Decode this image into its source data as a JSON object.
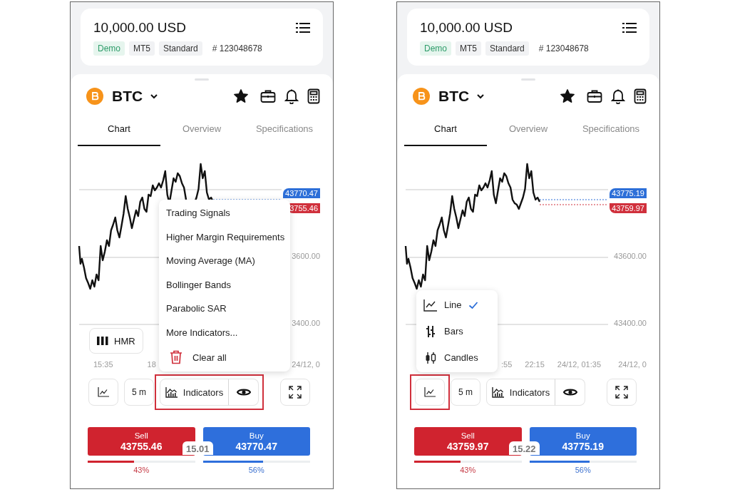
{
  "panels": [
    {
      "account": {
        "balance": "10,000.00 USD",
        "tags": [
          {
            "label": "Demo",
            "kind": "status"
          },
          {
            "label": "MT5",
            "kind": "plain"
          },
          {
            "label": "Standard",
            "kind": "plain"
          }
        ],
        "number": "# 123048678"
      },
      "symbol": "BTC",
      "favorite": true,
      "tabs": [
        {
          "label": "Chart",
          "selected": true
        },
        {
          "label": "Overview",
          "selected": false
        },
        {
          "label": "Specifications",
          "selected": false
        }
      ],
      "chart": {
        "y_labels": [
          "3600.00",
          "3400.00"
        ],
        "x_labels": [
          "15:35",
          "18",
          "24/12, 0"
        ],
        "ask_price": "43770.47",
        "bid_price": "3755.46",
        "hmr_button": "HMR"
      },
      "popup": {
        "kind": "indicators",
        "items": [
          {
            "label": "Trading Signals",
            "kind": "option"
          },
          {
            "label": "Higher Margin Requirements",
            "kind": "option"
          },
          {
            "label": "Moving Average (MA)",
            "kind": "option"
          },
          {
            "label": "Bollinger Bands",
            "kind": "option"
          },
          {
            "label": "Parabolic SAR",
            "kind": "option"
          },
          {
            "label": "More Indicators...",
            "kind": "option"
          },
          {
            "label": "Clear all",
            "kind": "clear"
          }
        ]
      },
      "toolbar": {
        "timeframe": "5 m",
        "indicators": "Indicators",
        "chart_type_highlighted": false,
        "indicators_highlighted": true
      },
      "trade": {
        "sell": {
          "label": "Sell",
          "price": "43755.46"
        },
        "buy": {
          "label": "Buy",
          "price": "43770.47"
        },
        "spread": "15.01",
        "sell_share": {
          "level": 0.43,
          "reading": "43%"
        },
        "buy_share": {
          "level": 0.56,
          "reading": "56%"
        }
      }
    },
    {
      "account": {
        "balance": "10,000.00 USD",
        "tags": [
          {
            "label": "Demo",
            "kind": "status"
          },
          {
            "label": "MT5",
            "kind": "plain"
          },
          {
            "label": "Standard",
            "kind": "plain"
          }
        ],
        "number": "# 123048678"
      },
      "symbol": "BTC",
      "favorite": true,
      "tabs": [
        {
          "label": "Chart",
          "selected": true
        },
        {
          "label": "Overview",
          "selected": false
        },
        {
          "label": "Specifications",
          "selected": false
        }
      ],
      "chart": {
        "y_labels": [
          "43600.00",
          "43400.00"
        ],
        "x_labels": [
          ":55",
          "22:15",
          "24/12, 01:35",
          "24/12, 0"
        ],
        "ask_price": "43775.19",
        "bid_price": "43759.97"
      },
      "popup": {
        "kind": "chart_type",
        "items": [
          {
            "label": "Line",
            "kind": "line",
            "selected": true
          },
          {
            "label": "Bars",
            "kind": "bars",
            "selected": false
          },
          {
            "label": "Candles",
            "kind": "candles",
            "selected": false
          }
        ]
      },
      "toolbar": {
        "timeframe": "5 m",
        "indicators": "Indicators",
        "chart_type_highlighted": true,
        "indicators_highlighted": false
      },
      "trade": {
        "sell": {
          "label": "Sell",
          "price": "43759.97"
        },
        "buy": {
          "label": "Buy",
          "price": "43775.19"
        },
        "spread": "15.22",
        "sell_share": {
          "level": 0.43,
          "reading": "43%"
        },
        "buy_share": {
          "level": 0.56,
          "reading": "56%"
        }
      }
    }
  ]
}
